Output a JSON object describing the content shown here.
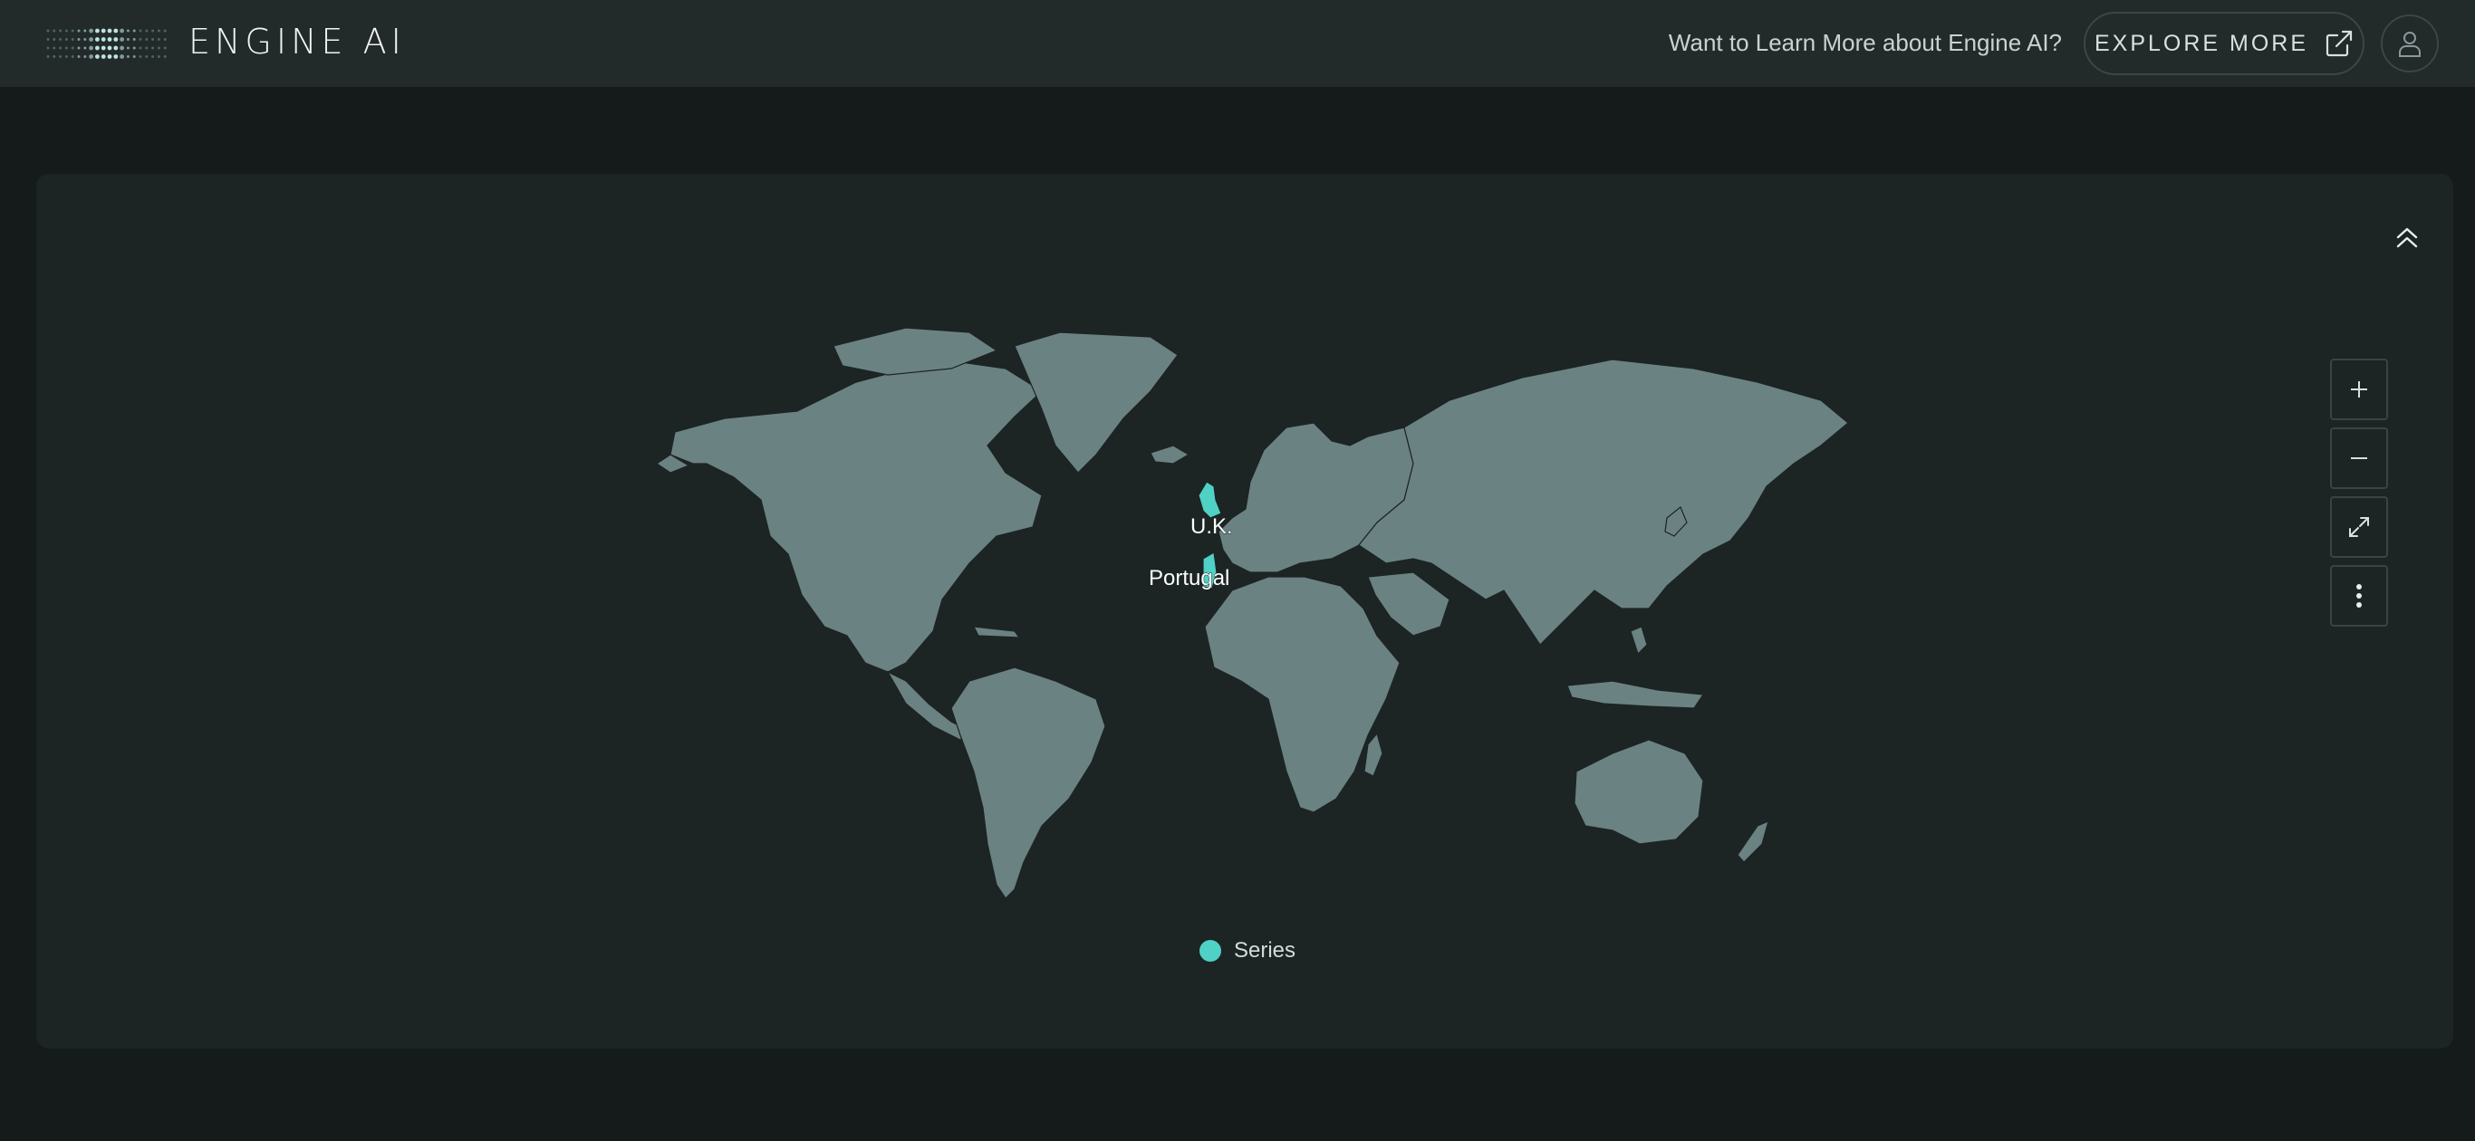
{
  "header": {
    "brand": "ENGINE AI",
    "learn_more": "Want to Learn More about Engine AI?",
    "explore_label": "EXPLORE MORE",
    "icons": {
      "logo": "dots-logo-icon",
      "explore": "external-link-icon",
      "avatar": "user-icon"
    }
  },
  "map": {
    "controls": [
      {
        "name": "zoom-in-button",
        "icon": "plus-icon"
      },
      {
        "name": "zoom-out-button",
        "icon": "minus-icon"
      },
      {
        "name": "fullscreen-button",
        "icon": "expand-icon"
      },
      {
        "name": "more-options-button",
        "icon": "vertical-dots-icon"
      }
    ],
    "collapse_icon": "double-chevron-up-icon",
    "labels": {
      "uk": "U.K.",
      "portugal": "Portugal"
    },
    "highlighted": [
      "U.K.",
      "Portugal"
    ],
    "legend": {
      "label": "Series",
      "color": "#4fd1c5"
    },
    "colors": {
      "land": "#6b8282",
      "highlight": "#4fd1c5",
      "card": "#1c2424"
    }
  }
}
